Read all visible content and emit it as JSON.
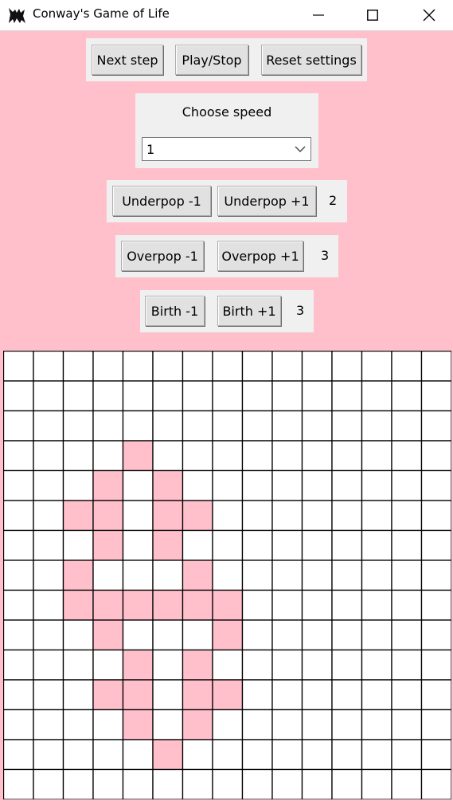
{
  "window": {
    "title": "Conway's Game of Life",
    "icon": "game-of-life-app-icon",
    "controls": [
      "minimize-icon",
      "maximize-icon",
      "close-icon"
    ]
  },
  "toolbar": {
    "next_step": "Next step",
    "play_stop": "Play/Stop",
    "reset_settings": "Reset settings"
  },
  "speed": {
    "label": "Choose speed",
    "selected": "1"
  },
  "underpop": {
    "minus": "Underpop -1",
    "plus": "Underpop +1",
    "value": "2"
  },
  "overpop": {
    "minus": "Overpop -1",
    "plus": "Overpop +1",
    "value": "3"
  },
  "birth": {
    "minus": "Birth -1",
    "plus": "Birth +1",
    "value": "3"
  },
  "board": {
    "columns": 15,
    "rows": 15,
    "alive_color": "#ffc0cb",
    "dead_color": "#ffffff",
    "line_color": "#000000",
    "alive_cells": [
      [
        3,
        4
      ],
      [
        4,
        3
      ],
      [
        4,
        5
      ],
      [
        5,
        2
      ],
      [
        5,
        3
      ],
      [
        5,
        5
      ],
      [
        5,
        6
      ],
      [
        6,
        3
      ],
      [
        6,
        5
      ],
      [
        7,
        2
      ],
      [
        7,
        6
      ],
      [
        8,
        2
      ],
      [
        8,
        3
      ],
      [
        8,
        4
      ],
      [
        8,
        5
      ],
      [
        8,
        6
      ],
      [
        8,
        7
      ],
      [
        9,
        3
      ],
      [
        9,
        7
      ],
      [
        10,
        4
      ],
      [
        10,
        6
      ],
      [
        11,
        3
      ],
      [
        11,
        4
      ],
      [
        11,
        6
      ],
      [
        11,
        7
      ],
      [
        12,
        4
      ],
      [
        12,
        6
      ],
      [
        13,
        5
      ]
    ]
  },
  "colors": {
    "background": "#ffc0cb",
    "panel": "#f0f0f0",
    "button": "#e1e1e1"
  }
}
